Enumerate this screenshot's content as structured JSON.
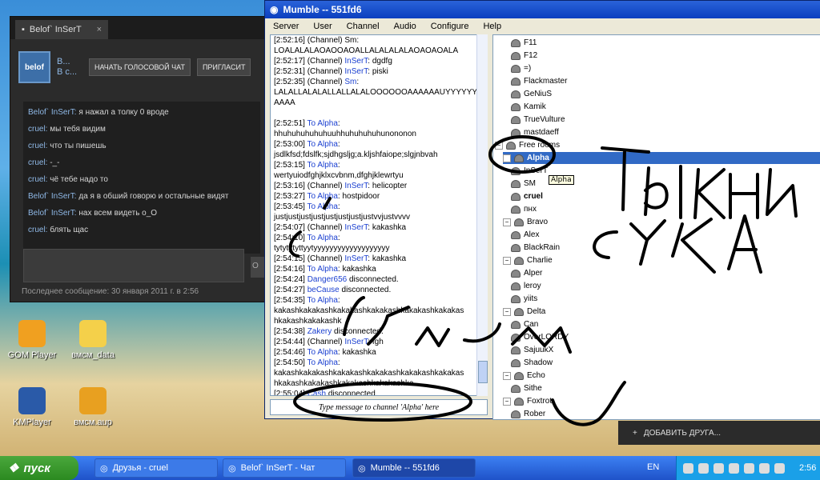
{
  "desktop": {
    "icons": [
      {
        "label": "GOM Player",
        "color": "#f0a020"
      },
      {
        "label": "вмсм_data",
        "color": "#f4d04a"
      },
      {
        "label": "KMPlayer",
        "color": "#2a5aa8"
      },
      {
        "label": "вмсм.aup",
        "color": "#e8a020"
      }
    ]
  },
  "steam_chat": {
    "tab_title": "Belof` InSerT",
    "tab_close": "×",
    "avatar_text": "belof",
    "name_line1": "В...",
    "name_line2": "В с...",
    "voice_button": "НАЧАТЬ ГОЛОСОВОЙ ЧАТ",
    "invite_button": "ПРИГЛАСИТ",
    "send_button": "О",
    "messages": [
      {
        "who": "Belof` InSerT:",
        "text": " я нажал а толку 0 вроде"
      },
      {
        "who": "cruel:",
        "text": " мы тебя видим"
      },
      {
        "who": "cruel:",
        "text": " что ты пишешь"
      },
      {
        "who": "cruel:",
        "text": " -_-"
      },
      {
        "who": "cruel:",
        "text": " чё тебе надо то"
      },
      {
        "who": "Belof` InSerT:",
        "text": " да я в обший говорю и остальные видят"
      },
      {
        "who": "Belof` InSerT:",
        "text": " нах всем видеть о_О"
      },
      {
        "who": "cruel:",
        "text": " блять щас"
      }
    ],
    "last_message": "Последнее сообщение: 30 января 2011 г. в 2:56"
  },
  "mumble": {
    "title": "Mumble -- 551fd6",
    "menu": [
      "Server",
      "User",
      "Channel",
      "Audio",
      "Configure",
      "Help"
    ],
    "log": [
      {
        "t": "[2:52:16] (Channel) Sm:"
      },
      {
        "t": "LOALALALAOAOOAOALLALALALALAOAOAOALA"
      },
      {
        "t": "[2:52:17] (Channel) ",
        "b": "InSerT",
        "r": ": dgdfg"
      },
      {
        "t": "[2:52:31] (Channel) ",
        "b": "InSerT",
        "r": ": piski"
      },
      {
        "t": "[2:52:35] (Channel) ",
        "b": "Sm",
        "r": ":"
      },
      {
        "t": "LALALLALALALLALLALALOOOOOOAAAAAAUYYYYYY"
      },
      {
        "t": "AAAA"
      },
      {
        "t": " "
      },
      {
        "t": "[2:52:51] ",
        "b": "To Alpha",
        "r": ":"
      },
      {
        "t": "hhuhuhuhuhuhuuhhuhuhuhuhunononon"
      },
      {
        "t": "[2:53:00] ",
        "b": "To Alpha",
        "r": ":"
      },
      {
        "t": "jsdlkfsd;fdslfk;sjdhgsljg;a.kljshfaiope;slgjnbvah"
      },
      {
        "t": "[2:53:15] ",
        "b": "To Alpha",
        "r": ":"
      },
      {
        "t": "wertyuiodfghjklxcvbnm,dfghjklewrtyu"
      },
      {
        "t": "[2:53:16] (Channel) ",
        "b": "InSerT",
        "r": ": helicopter"
      },
      {
        "t": "[2:53:27] ",
        "b": "To Alpha",
        "r": ": hostpidoor"
      },
      {
        "t": "[2:53:45] ",
        "b": "To Alpha",
        "r": ":"
      },
      {
        "t": "justjustjustjustjustjustjustjustvvjustvvvv"
      },
      {
        "t": "[2:54:07] (Channel) ",
        "b": "InSerT",
        "r": ": kakashka"
      },
      {
        "t": "[2:54:10] ",
        "b": "To Alpha",
        "r": ":"
      },
      {
        "t": "tytytytyttyytyyyyyyyyyyyyyyyyyyy"
      },
      {
        "t": "[2:54:15] (Channel) ",
        "b": "InSerT",
        "r": ": kakashka"
      },
      {
        "t": "[2:54:16] ",
        "b": "To Alpha",
        "r": ": kakashka"
      },
      {
        "t": "[2:54:24] ",
        "b": "Danger656",
        "r": " disconnected."
      },
      {
        "t": "[2:54:27] ",
        "b": "beCause",
        "r": " disconnected."
      },
      {
        "t": "[2:54:35] ",
        "b": "To Alpha",
        "r": ":"
      },
      {
        "t": "kakashkakakashkakakashkakakashkakakashkakakas"
      },
      {
        "t": "hkakashkakakashk"
      },
      {
        "t": "[2:54:38] ",
        "b": "Zakery",
        "r": " disconnected."
      },
      {
        "t": "[2:54:44] (Channel) ",
        "b": "InSerT",
        "r": ": fgh"
      },
      {
        "t": "[2:54:46] ",
        "b": "To Alpha",
        "r": ": kakashka"
      },
      {
        "t": "[2:54:50] ",
        "b": "To Alpha",
        "r": ":"
      },
      {
        "t": "kakashkakakashkakakashkakakashkakakashkakakas"
      },
      {
        "t": "hkakashkakakashkakakashkakakashka"
      },
      {
        "t": "[2:55:04] ",
        "b": "Cash",
        "r": " disconnected."
      }
    ],
    "message_placeholder": "Type message to channel 'Alpha' here",
    "tooltip": "Alpha",
    "tree": [
      {
        "label": "F11",
        "indent": 2
      },
      {
        "label": "F12",
        "indent": 2
      },
      {
        "label": "=)",
        "indent": 2
      },
      {
        "label": "Flackmaster",
        "indent": 2
      },
      {
        "label": "GeNiuS",
        "indent": 2
      },
      {
        "label": "Kamik",
        "indent": 2
      },
      {
        "label": "TrueVulture",
        "indent": 2
      },
      {
        "label": "mastdaeff",
        "indent": 2
      },
      {
        "label": "Free rooms",
        "indent": 0,
        "channel": true
      },
      {
        "label": "Alpha",
        "indent": 1,
        "channel": true,
        "selected": true
      },
      {
        "label": "InSerT",
        "indent": 2
      },
      {
        "label": "SM",
        "indent": 2
      },
      {
        "label": "cruel",
        "indent": 2,
        "bold": true
      },
      {
        "label": "пнх",
        "indent": 2
      },
      {
        "label": "Bravo",
        "indent": 1,
        "channel": true
      },
      {
        "label": "Alex",
        "indent": 2
      },
      {
        "label": "BlackRain",
        "indent": 2
      },
      {
        "label": "Charlie",
        "indent": 1,
        "channel": true
      },
      {
        "label": "Alper",
        "indent": 2
      },
      {
        "label": "leroy",
        "indent": 2
      },
      {
        "label": "yiits",
        "indent": 2
      },
      {
        "label": "Delta",
        "indent": 1,
        "channel": true
      },
      {
        "label": "Can",
        "indent": 2
      },
      {
        "label": "OverLORDY",
        "indent": 2
      },
      {
        "label": "SajuukX",
        "indent": 2
      },
      {
        "label": "Shadow",
        "indent": 2
      },
      {
        "label": "Echo",
        "indent": 1,
        "channel": true
      },
      {
        "label": "Sithe",
        "indent": 2
      },
      {
        "label": "Foxtrot",
        "indent": 1,
        "channel": true
      },
      {
        "label": "Rober",
        "indent": 2
      }
    ]
  },
  "add_friend": {
    "label": "ДОБАВИТЬ ДРУГА..."
  },
  "taskbar": {
    "start_label": "пуск",
    "tasks": [
      {
        "label": "Друзья - cruel",
        "active": false
      },
      {
        "label": "Belof` InSerT - Чат",
        "active": false
      },
      {
        "label": "Mumble -- 551fd6",
        "active": true
      }
    ],
    "language": "EN",
    "clock": "2:56"
  }
}
